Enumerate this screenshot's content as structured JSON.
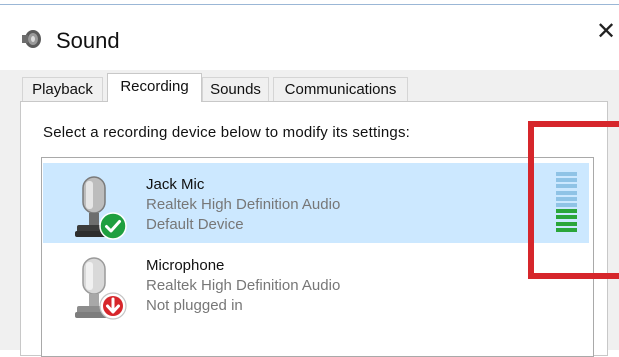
{
  "window": {
    "title": "Sound",
    "close_glyph": "✕"
  },
  "tabs": [
    {
      "label": "Playback",
      "active": false
    },
    {
      "label": "Recording",
      "active": true
    },
    {
      "label": "Sounds",
      "active": false
    },
    {
      "label": "Communications",
      "active": false
    }
  ],
  "instruction": "Select a recording device below to modify its settings:",
  "devices": [
    {
      "name": "Jack Mic",
      "driver": "Realtek High Definition Audio",
      "status": "Default Device",
      "selected": true,
      "badge_icon": "green-check-icon",
      "level_fraction": 0.4
    },
    {
      "name": "Microphone",
      "driver": "Realtek High Definition Audio",
      "status": "Not plugged in",
      "selected": false,
      "badge_icon": "red-down-arrow-icon"
    }
  ],
  "colors": {
    "selection": "#cce8ff",
    "meter_active": "#2aa63a",
    "meter_inactive": "#8fc3e6",
    "annotation_box": "#d6262b"
  }
}
